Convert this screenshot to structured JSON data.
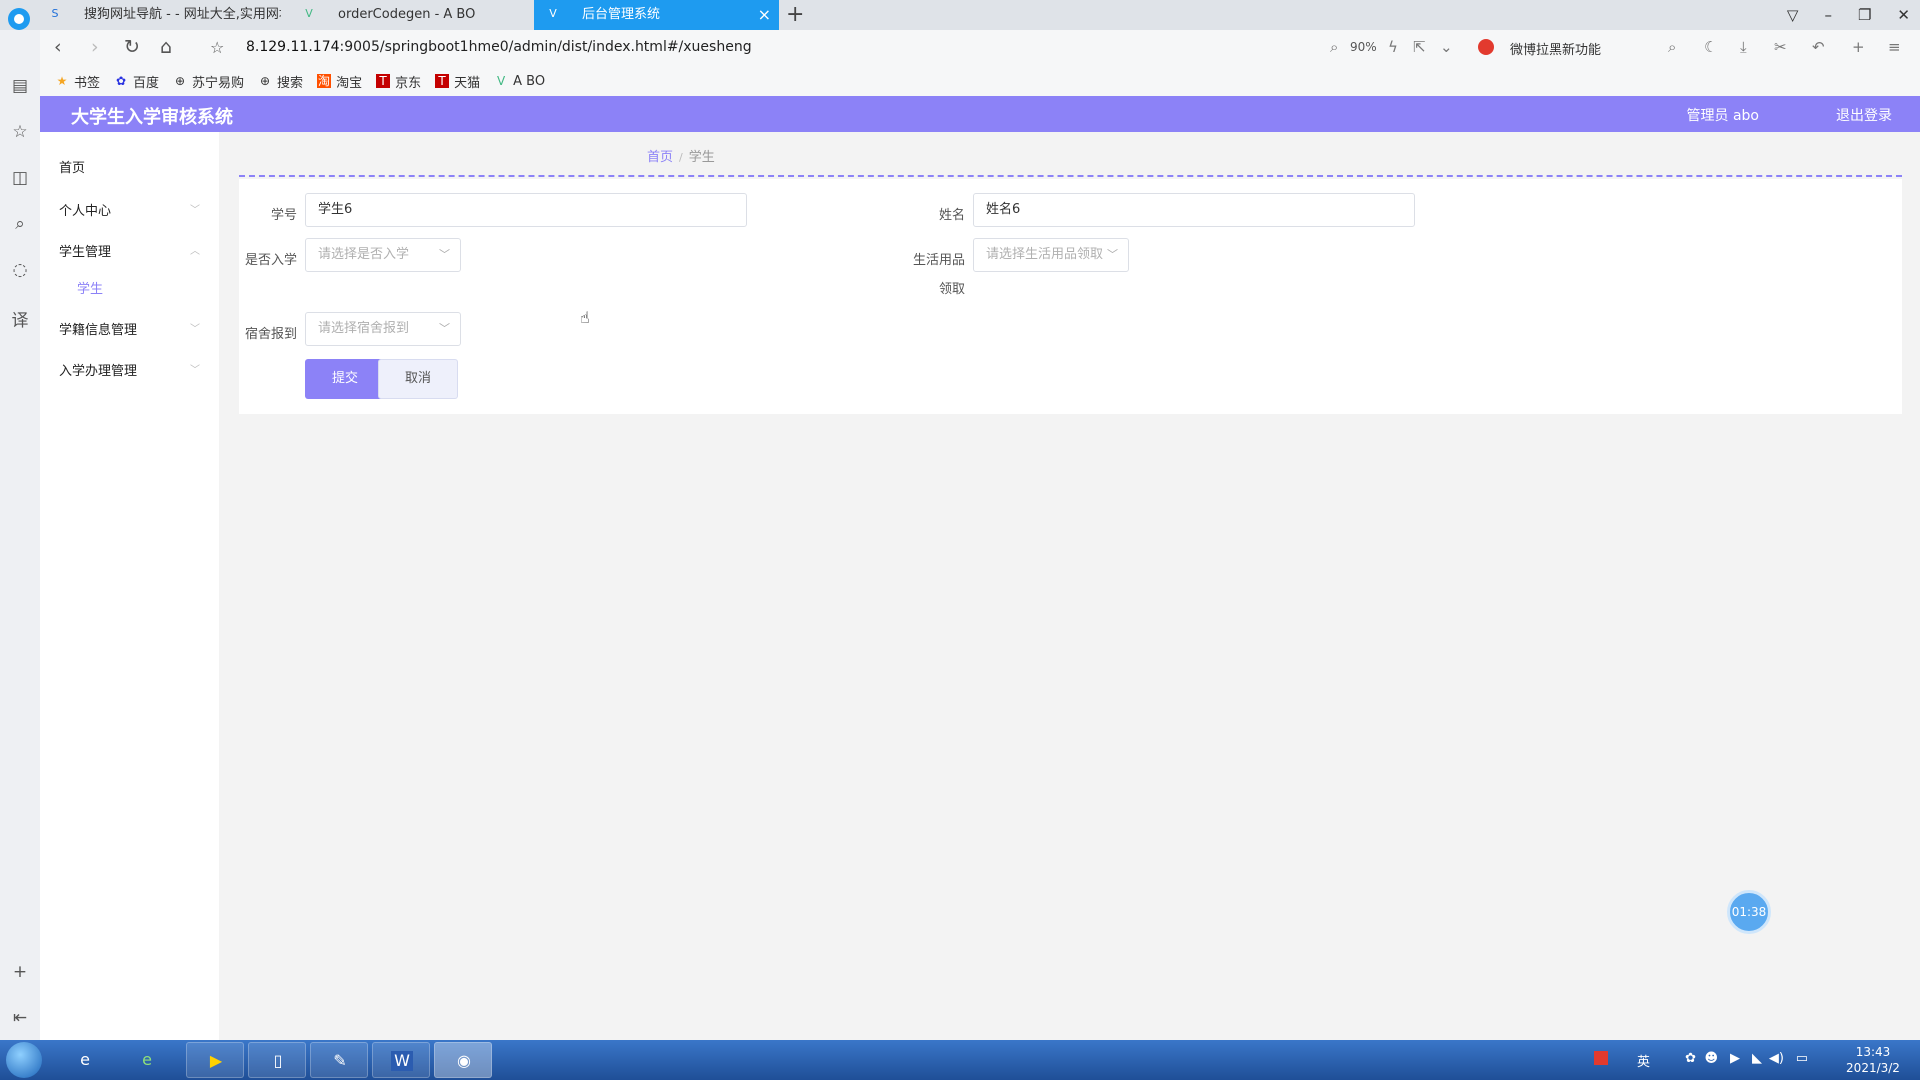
{
  "browser": {
    "tabs": [
      {
        "label": "搜狗网址导航 - - 网址大全,实用网址",
        "icon": "sogou-icon"
      },
      {
        "label": "orderCodegen - A BO",
        "icon": "vue-icon"
      },
      {
        "label": "后台管理系统",
        "icon": "vue-icon",
        "active": true
      }
    ],
    "url_host": "8.129.11.174",
    "url_rest": ":9005/springboot1hme0/admin/dist/index.html#/xuesheng",
    "zoom": "90%",
    "weibo_text": "微博拉黑新功能",
    "bookmarks": [
      "书签",
      "百度",
      "苏宁易购",
      "搜索",
      "淘宝",
      "京东",
      "天猫",
      "A BO"
    ]
  },
  "header": {
    "title": "大学生入学审核系统",
    "user": "管理员 abo",
    "logout": "退出登录"
  },
  "menu": {
    "home": "首页",
    "personal": "个人中心",
    "student_mgmt": "学生管理",
    "student": "学生",
    "record_mgmt": "学籍信息管理",
    "enroll_mgmt": "入学办理管理"
  },
  "breadcrumb": {
    "home": "首页",
    "sep": "/",
    "current": "学生"
  },
  "form": {
    "student_no_label": "学号",
    "student_no_value": "学生6",
    "name_label": "姓名",
    "name_value": "姓名6",
    "enrolled_label": "是否入学",
    "enrolled_placeholder": "请选择是否入学",
    "supplies_label_1": "生活用品",
    "supplies_label_2": "领取",
    "supplies_placeholder": "请选择生活用品领取",
    "dorm_label": "宿舍报到",
    "dorm_placeholder": "请选择宿舍报到",
    "submit": "提交",
    "cancel": "取消"
  },
  "timer": "01:38",
  "taskbar": {
    "lang": "英",
    "time": "13:43",
    "date": "2021/3/2"
  }
}
